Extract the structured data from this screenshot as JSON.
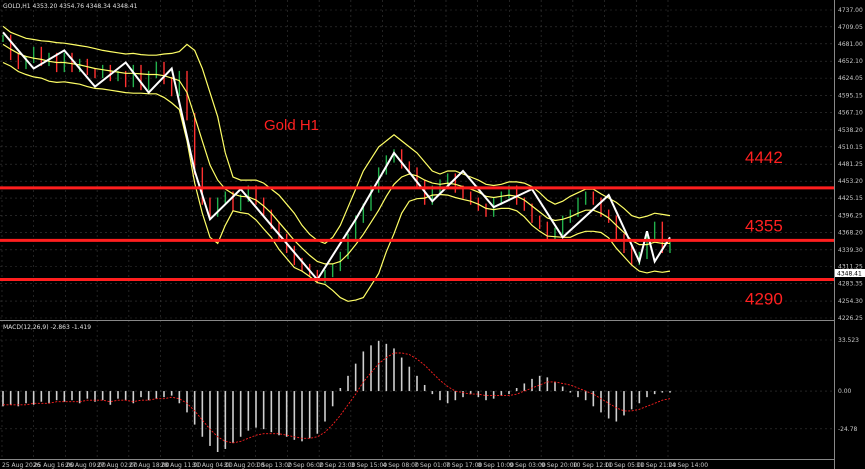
{
  "chart_data": {
    "type": "line",
    "symbol_header": "GOLD,H1  4353.20 4354.76 4348.34 4348.41",
    "macd_header": "MACD(12,26,9) -2.863 -1.419",
    "chart_label": "Gold H1",
    "price_axis": {
      "ylim": [
        4226.25,
        4737.0
      ],
      "ticks": [
        "4737.00",
        "4709.05",
        "4681.00",
        "4652.10",
        "4624.05",
        "4595.15",
        "4567.10",
        "4538.20",
        "4510.15",
        "4481.25",
        "4453.20",
        "4425.15",
        "4396.25",
        "4368.20",
        "4339.30",
        "4311.25",
        "4283.35",
        "4254.30",
        "4226.25"
      ],
      "current_price": "4348.41"
    },
    "macd_axis": {
      "ylim": [
        -40,
        33.523
      ],
      "ticks": [
        "33.523",
        "0.00",
        "-24.78"
      ]
    },
    "x_ticks": [
      "25 Aug 2026",
      "25 Aug 16:00",
      "26 Aug 09:00",
      "27 Aug 02:00",
      "27 Aug 18:00",
      "28 Aug 11:00",
      "31 Aug 04:00",
      "31 Aug 20:00",
      "1 Sep 13:00",
      "2 Sep 06:00",
      "2 Sep 23:00",
      "3 Sep 15:00",
      "4 Sep 08:00",
      "7 Sep 01:00",
      "7 Sep 17:00",
      "8 Sep 10:00",
      "9 Sep 03:00",
      "9 Sep 20:00",
      "10 Sep 12:00",
      "11 Sep 05:00",
      "11 Sep 21:00",
      "14 Sep 14:00"
    ],
    "levels": [
      {
        "value": 4442,
        "label": "4442",
        "color": "#ff1e1e"
      },
      {
        "value": 4355,
        "label": "4355",
        "color": "#ff1e1e"
      },
      {
        "value": 4290,
        "label": "4290",
        "color": "#ff1e1e"
      }
    ],
    "series": [
      {
        "role": "price",
        "color": "#22b14c",
        "values": [
          4690,
          4660,
          4645,
          4655,
          4670,
          4650,
          4660,
          4640,
          4660,
          4640,
          4650,
          4635,
          4630,
          4640,
          4625,
          4630,
          4615,
          4640,
          4610,
          4630,
          4645,
          4620,
          4600,
          4630,
          4560,
          4470,
          4420,
          4400,
          4420,
          4430,
          4410,
          4425,
          4440,
          4420,
          4400,
          4380,
          4360,
          4340,
          4320,
          4310,
          4300,
          4290,
          4300,
          4310,
          4330,
          4360,
          4390,
          4410,
          4440,
          4470,
          4490,
          4500,
          4480,
          4470,
          4450,
          4420,
          4440,
          4450,
          4460,
          4440,
          4430,
          4420,
          4410,
          4400,
          4420,
          4430,
          4440,
          4420,
          4410,
          4390,
          4380,
          4360,
          4370,
          4390,
          4400,
          4420,
          4430,
          4420,
          4400,
          4390,
          4360,
          4340,
          4320,
          4330,
          4360,
          4380,
          4340,
          4350
        ]
      },
      {
        "role": "zigzag",
        "color": "#ffffff",
        "points": [
          [
            0,
            4700
          ],
          [
            4,
            4640
          ],
          [
            8,
            4670
          ],
          [
            12,
            4610
          ],
          [
            16,
            4650
          ],
          [
            19,
            4600
          ],
          [
            22,
            4640
          ],
          [
            25,
            4470
          ],
          [
            27,
            4390
          ],
          [
            31,
            4440
          ],
          [
            35,
            4380
          ],
          [
            41,
            4290
          ],
          [
            46,
            4390
          ],
          [
            51,
            4500
          ],
          [
            56,
            4420
          ],
          [
            60,
            4470
          ],
          [
            64,
            4410
          ],
          [
            69,
            4440
          ],
          [
            73,
            4360
          ],
          [
            79,
            4430
          ],
          [
            83,
            4320
          ],
          [
            84,
            4370
          ],
          [
            85,
            4320
          ],
          [
            87,
            4360
          ]
        ]
      },
      {
        "role": "bollinger-middle",
        "color": "#ffff66",
        "values": [
          4680,
          4672,
          4665,
          4660,
          4657,
          4655,
          4652,
          4650,
          4650,
          4648,
          4646,
          4643,
          4640,
          4638,
          4636,
          4634,
          4632,
          4632,
          4631,
          4630,
          4630,
          4628,
          4624,
          4620,
          4600,
          4560,
          4520,
          4480,
          4455,
          4440,
          4432,
          4428,
          4427,
          4422,
          4412,
          4400,
          4385,
          4370,
          4355,
          4342,
          4330,
          4320,
          4316,
          4316,
          4320,
          4332,
          4348,
          4365,
          4385,
          4405,
          4428,
          4448,
          4460,
          4465,
          4462,
          4455,
          4450,
          4448,
          4450,
          4448,
          4444,
          4440,
          4435,
          4428,
          4426,
          4428,
          4430,
          4428,
          4422,
          4412,
          4402,
          4392,
          4388,
          4390,
          4394,
          4400,
          4405,
          4405,
          4400,
          4392,
          4380,
          4368,
          4355,
          4348,
          4348,
          4352,
          4350,
          4350
        ]
      },
      {
        "role": "bollinger-upper",
        "color": "#ffff66",
        "values": [
          4710,
          4700,
          4695,
          4690,
          4688,
          4686,
          4685,
          4683,
          4682,
          4680,
          4678,
          4676,
          4673,
          4670,
          4668,
          4666,
          4664,
          4665,
          4663,
          4662,
          4662,
          4664,
          4665,
          4668,
          4680,
          4670,
          4640,
          4600,
          4560,
          4500,
          4460,
          4455,
          4455,
          4455,
          4450,
          4440,
          4430,
          4415,
          4400,
          4380,
          4365,
          4355,
          4350,
          4360,
          4380,
          4410,
          4440,
          4470,
          4490,
          4510,
          4520,
          4530,
          4520,
          4510,
          4500,
          4485,
          4470,
          4465,
          4470,
          4470,
          4465,
          4460,
          4455,
          4448,
          4446,
          4448,
          4452,
          4452,
          4450,
          4444,
          4434,
          4422,
          4415,
          4420,
          4428,
          4434,
          4440,
          4440,
          4432,
          4425,
          4418,
          4408,
          4396,
          4392,
          4395,
          4400,
          4398,
          4396
        ]
      },
      {
        "role": "bollinger-lower",
        "color": "#ffff66",
        "values": [
          4650,
          4644,
          4635,
          4630,
          4626,
          4624,
          4619,
          4617,
          4618,
          4616,
          4614,
          4610,
          4607,
          4606,
          4604,
          4602,
          4600,
          4599,
          4599,
          4598,
          4598,
          4592,
          4583,
          4572,
          4520,
          4450,
          4400,
          4360,
          4350,
          4380,
          4404,
          4401,
          4399,
          4389,
          4374,
          4360,
          4340,
          4325,
          4310,
          4304,
          4295,
          4285,
          4282,
          4272,
          4260,
          4254,
          4256,
          4260,
          4280,
          4300,
          4336,
          4366,
          4400,
          4420,
          4424,
          4425,
          4430,
          4431,
          4430,
          4426,
          4423,
          4420,
          4415,
          4408,
          4406,
          4408,
          4408,
          4404,
          4394,
          4380,
          4370,
          4362,
          4361,
          4360,
          4360,
          4366,
          4370,
          4370,
          4368,
          4359,
          4342,
          4328,
          4314,
          4304,
          4301,
          4304,
          4302,
          4304
        ]
      },
      {
        "role": "macd-histogram",
        "color": "#d0d0d0",
        "values": [
          -10,
          -9,
          -10,
          -8,
          -9,
          -7,
          -8,
          -6,
          -7,
          -6,
          -8,
          -5,
          -7,
          -6,
          -9,
          -5,
          -6,
          -8,
          -4,
          -6,
          -5,
          -4,
          -3,
          -8,
          -14,
          -22,
          -30,
          -36,
          -40,
          -38,
          -34,
          -30,
          -26,
          -24,
          -25,
          -27,
          -29,
          -30,
          -32,
          -33,
          -31,
          -28,
          -20,
          -10,
          2,
          10,
          18,
          26,
          30,
          33,
          31,
          28,
          22,
          16,
          10,
          4,
          -2,
          -6,
          -8,
          -6,
          -4,
          -2,
          -4,
          -6,
          -5,
          -3,
          -2,
          2,
          5,
          8,
          10,
          9,
          6,
          3,
          -1,
          -4,
          -6,
          -10,
          -14,
          -18,
          -20,
          -16,
          -12,
          -8,
          -4,
          -2,
          -1,
          -1
        ]
      },
      {
        "role": "macd-signal",
        "color": "#ff2020",
        "values": [
          -9,
          -9,
          -9,
          -9,
          -8,
          -8,
          -8,
          -7,
          -7,
          -7,
          -7,
          -6,
          -6,
          -6,
          -7,
          -6,
          -6,
          -7,
          -6,
          -6,
          -5,
          -5,
          -4,
          -5,
          -8,
          -13,
          -19,
          -25,
          -30,
          -33,
          -34,
          -33,
          -31,
          -29,
          -28,
          -28,
          -28,
          -29,
          -30,
          -31,
          -31,
          -30,
          -27,
          -22,
          -16,
          -9,
          -2,
          6,
          12,
          18,
          22,
          25,
          25,
          24,
          21,
          17,
          12,
          7,
          3,
          0,
          -1,
          -2,
          -2,
          -3,
          -3,
          -3,
          -3,
          -2,
          0,
          2,
          4,
          6,
          6,
          5,
          4,
          2,
          0,
          -2,
          -5,
          -8,
          -11,
          -13,
          -13,
          -12,
          -10,
          -8,
          -6,
          -5
        ]
      }
    ]
  }
}
